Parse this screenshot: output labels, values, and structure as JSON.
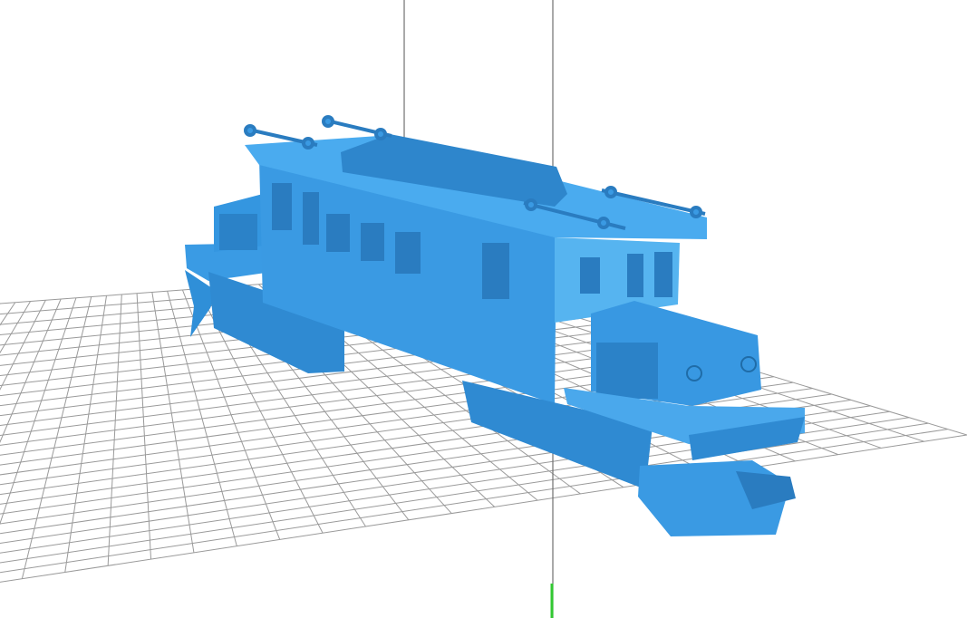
{
  "viewport": {
    "background_color": "#ffffff",
    "bed_grid_color": "#9a9a9a",
    "model_color": "#3b9ee6",
    "model_shadow_color": "#2a7fc4",
    "model_highlight_color": "#6cc0f5",
    "axis_line_color": "#707070",
    "z_axis_color": "#32c832"
  },
  "scene": {
    "object_name_icon": "locomotive-model"
  }
}
